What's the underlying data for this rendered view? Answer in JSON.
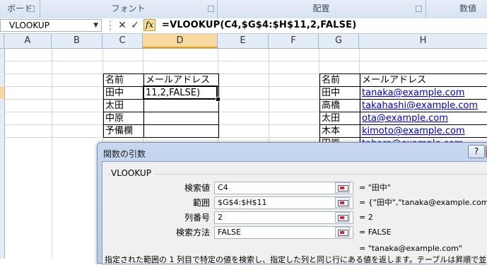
{
  "ribbon": {
    "groups": [
      "ボード",
      "フォント",
      "配置",
      "数値"
    ]
  },
  "formula_bar": {
    "name_box": "VLOOKUP",
    "cancel": "✕",
    "enter": "✓",
    "fx": "fx",
    "formula": "=VLOOKUP(C4,$G$4:$H$11,2,FALSE)"
  },
  "columns": [
    "A",
    "B",
    "C",
    "D",
    "E",
    "F",
    "G",
    "H"
  ],
  "left_table": {
    "headers": [
      "名前",
      "メールアドレス"
    ],
    "rows": [
      [
        "田中",
        "11,2,FALSE)"
      ],
      [
        "太田",
        ""
      ],
      [
        "中原",
        ""
      ],
      [
        "予備欄",
        ""
      ]
    ]
  },
  "right_table": {
    "headers": [
      "名前",
      "メールアドレス"
    ],
    "rows": [
      [
        "田中",
        "tanaka@example.com"
      ],
      [
        "高橋",
        "takahashi@example.com"
      ],
      [
        "太田",
        "ota@example.com"
      ],
      [
        "木本",
        "kimoto@example.com"
      ],
      [
        "田原",
        "tahara@example.com"
      ]
    ]
  },
  "dialog": {
    "title": "関数の引数",
    "help": "?",
    "function_name": "VLOOKUP",
    "args": [
      {
        "label": "検索値",
        "value": "C4",
        "result": "= \"田中\""
      },
      {
        "label": "範囲",
        "value": "$G$4:$H$11",
        "result": "= {\"田中\",\"tanaka@example.com\";\"高"
      },
      {
        "label": "列番号",
        "value": "2",
        "result": "= 2"
      },
      {
        "label": "検索方法",
        "value": "FALSE",
        "result": "= FALSE"
      }
    ],
    "final_result": "= \"tanaka@example.com\"",
    "description": "指定された範囲の 1 列目で特定の値を検索し、指定した列と同じ行にある値を返します。テーブルは昇順で並べ替え"
  }
}
